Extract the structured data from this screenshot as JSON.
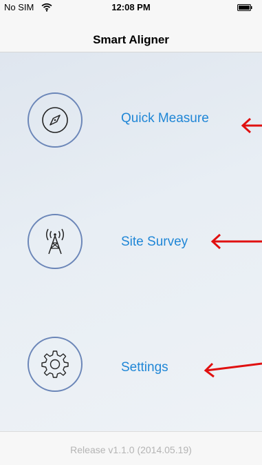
{
  "status": {
    "carrier": "No SIM",
    "time": "12:08 PM"
  },
  "navbar": {
    "title": "Smart Aligner"
  },
  "menu": [
    {
      "label": "Quick Measure",
      "icon": "compass-icon"
    },
    {
      "label": "Site Survey",
      "icon": "antenna-tower-icon"
    },
    {
      "label": "Settings",
      "icon": "gear-icon"
    }
  ],
  "footer": {
    "release": "Release v1.1.0 (2014.05.19)"
  },
  "colors": {
    "accent": "#1f86d6",
    "circle": "#6b86b8",
    "annotation": "#e01010"
  }
}
